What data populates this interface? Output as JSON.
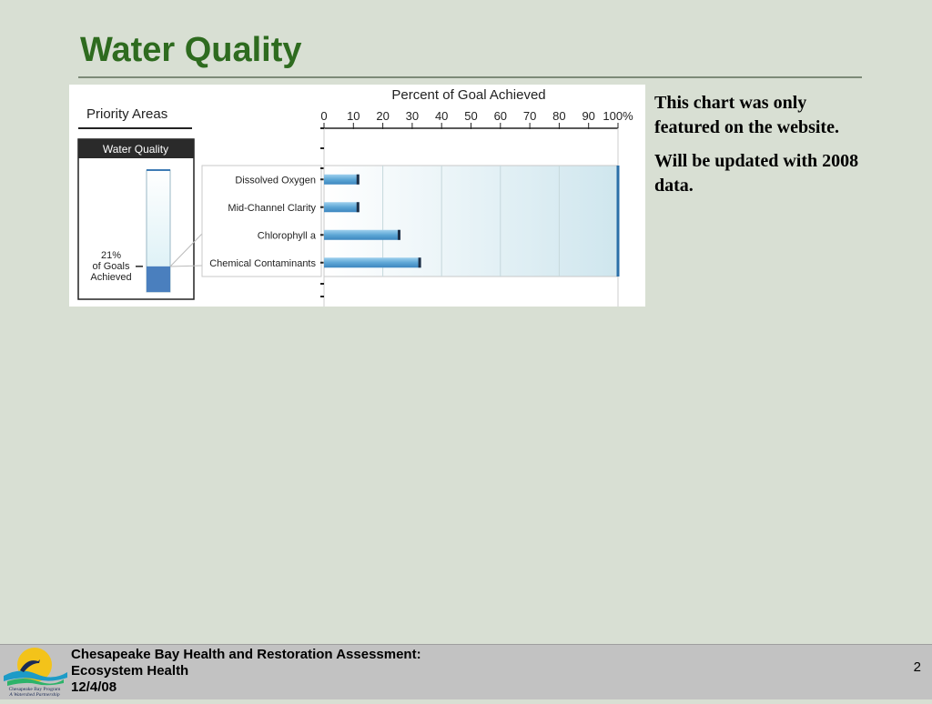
{
  "slide": {
    "title": "Water Quality",
    "note_lines": [
      "This chart was only featured on the website.",
      "Will be updated with 2008 data."
    ]
  },
  "chart_data": {
    "type": "bar",
    "title": "Percent of Goal Achieved",
    "orientation": "horizontal",
    "categories": [
      "Dissolved Oxygen",
      "Mid-Channel Clarity",
      "Chlorophyll a",
      "Chemical Contaminants"
    ],
    "values": [
      12,
      12,
      26,
      33
    ],
    "x_ticks": [
      "0",
      "10",
      "20",
      "30",
      "40",
      "50",
      "60",
      "70",
      "80",
      "90",
      "100%"
    ],
    "xlim": [
      0,
      100
    ],
    "colors": {
      "bar": "#5ea7d6",
      "bar_end": "#1f2f45",
      "band": "#dbeef3"
    },
    "priority_areas": {
      "heading": "Priority Areas",
      "column_label": "Water Quality",
      "overall_value": 21,
      "overall_label_lines": [
        "21%",
        "of Goals",
        "Achieved"
      ],
      "gauge_fill_color": "#4a7fbe"
    }
  },
  "footer": {
    "logo": {
      "icon": "chesapeake-bay-program-logo",
      "name": "Chesapeake Bay Program",
      "tagline": "A Watershed Partnership"
    },
    "lines": [
      "Chesapeake Bay Health and Restoration Assessment:",
      "Ecosystem Health",
      "12/4/08"
    ],
    "page_number": "2"
  }
}
